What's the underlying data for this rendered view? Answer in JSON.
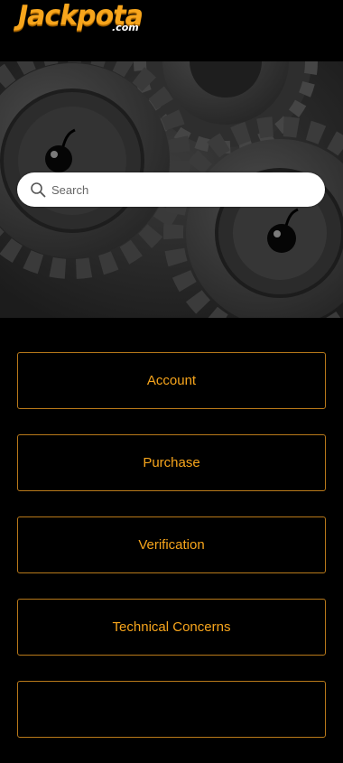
{
  "brand": {
    "logo_main": "Jackpota",
    "logo_sub": ".com",
    "accent_color": "#f7a51c"
  },
  "hero": {
    "background_theme": "gears-with-cherries"
  },
  "search": {
    "placeholder": "Search",
    "value": "",
    "icon": "search-icon"
  },
  "categories": [
    {
      "label": "Account"
    },
    {
      "label": "Purchase"
    },
    {
      "label": "Verification"
    },
    {
      "label": "Technical Concerns"
    },
    {
      "label": ""
    }
  ]
}
